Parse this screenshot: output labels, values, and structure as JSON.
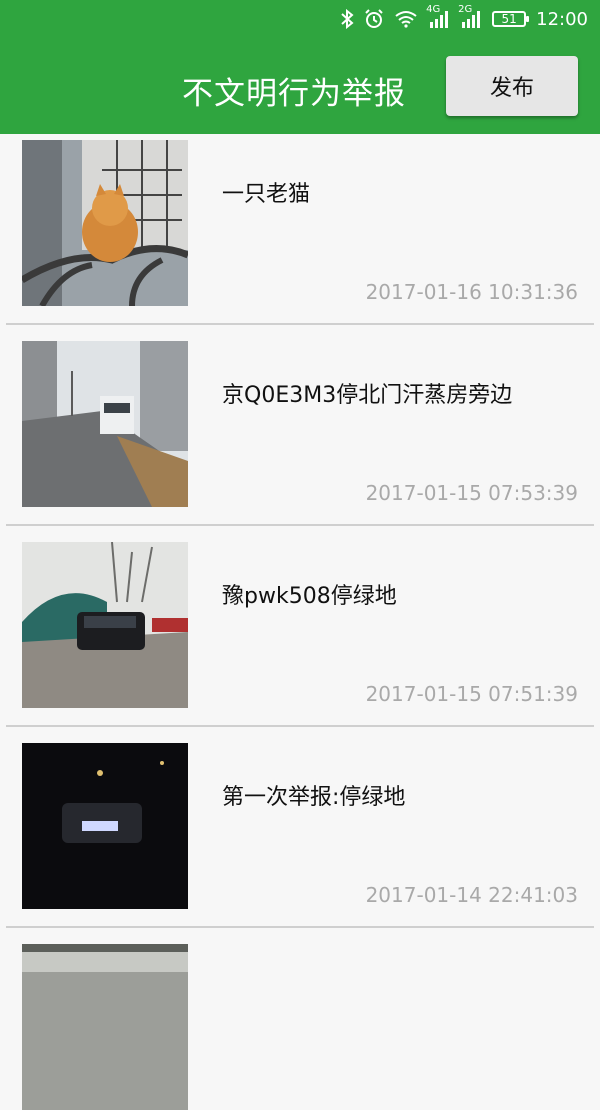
{
  "status_bar": {
    "network_1": "4G",
    "network_2": "2G",
    "battery": "51",
    "time": "12:00"
  },
  "header": {
    "title": "不文明行为举报",
    "publish_label": "发布"
  },
  "reports": [
    {
      "title": "一只老猫",
      "time": "2017-01-16 10:31:36",
      "image": "cat-on-tree-photo"
    },
    {
      "title": "京Q0E3M3停北门汗蒸房旁边",
      "time": "2017-01-15 07:53:39",
      "image": "van-on-street-photo"
    },
    {
      "title": "豫pwk508停绿地",
      "time": "2017-01-15 07:51:39",
      "image": "car-on-grass-photo"
    },
    {
      "title": "第一次举报:停绿地",
      "time": "2017-01-14 22:41:03",
      "image": "car-at-night-photo"
    }
  ],
  "colors": {
    "primary": "#2fa53f",
    "button_bg": "#e6e6e6",
    "timestamp": "#a9a9a9"
  }
}
